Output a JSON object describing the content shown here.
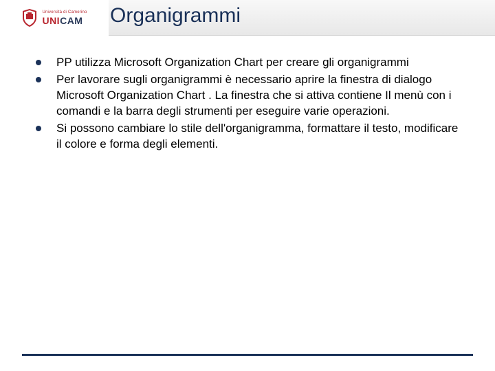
{
  "header": {
    "logo": {
      "upper_text": "Università di Camerino",
      "brand_left": "UNI",
      "brand_right": "CAM"
    },
    "title": "Organigrammi"
  },
  "content": {
    "bullets": [
      "PP utilizza Microsoft Organization Chart per creare gli organigrammi",
      "Per lavorare sugli organigrammi è necessario aprire la finestra di dialogo Microsoft Organization Chart . La finestra che si attiva contiene Il menù con i comandi e la barra degli strumenti per eseguire varie operazioni.",
      "Si possono cambiare lo stile dell'organigramma, formattare il testo,  modificare il  colore e forma degli elementi."
    ]
  },
  "colors": {
    "title": "#1a3158",
    "accent_red": "#b8252e",
    "footer_bar": "#1a3158"
  }
}
